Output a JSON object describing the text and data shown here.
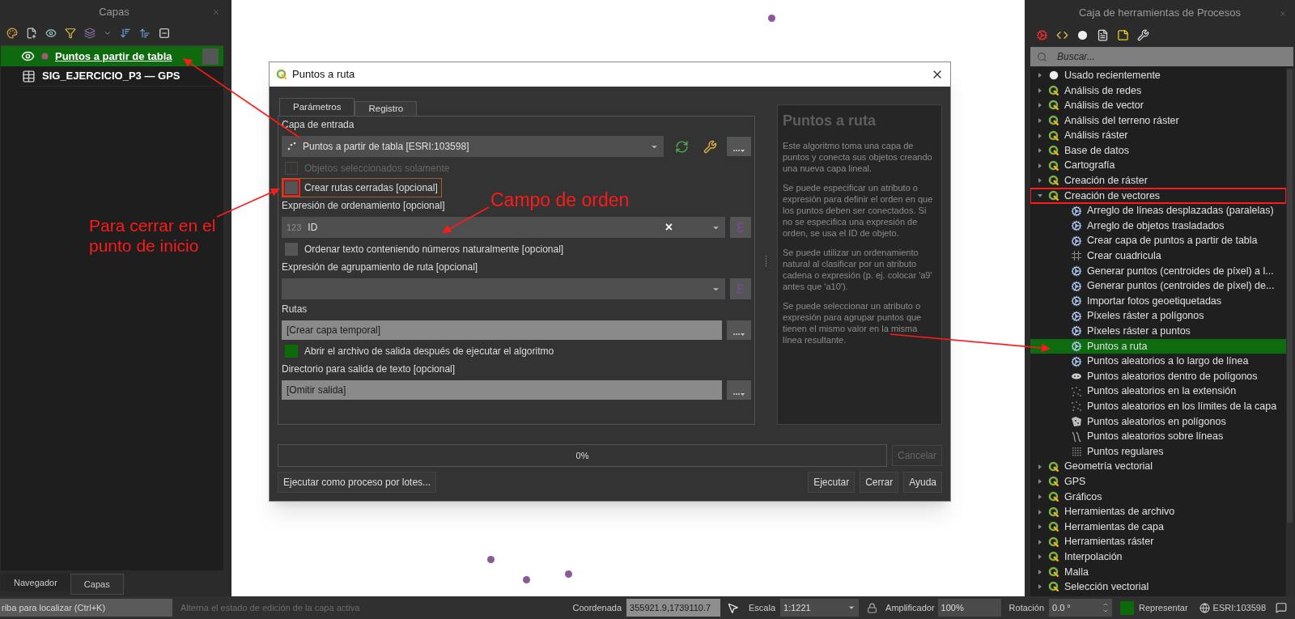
{
  "layers_panel": {
    "title": "Capas",
    "layers": [
      {
        "name": "Puntos a partir de tabla",
        "kind": "points",
        "selected": true
      },
      {
        "name": "SIG_EJERCICIO_P3 — GPS",
        "kind": "table",
        "selected": false
      }
    ],
    "tabs": [
      {
        "label": "Navegador",
        "selected": false
      },
      {
        "label": "Capas",
        "selected": true
      }
    ]
  },
  "dialog": {
    "title": "Puntos a ruta",
    "tabs": [
      {
        "label": "Parámetros",
        "selected": true
      },
      {
        "label": "Registro",
        "selected": false
      }
    ],
    "params": [
      {
        "kind": "label",
        "text": "Capa de entrada"
      },
      {
        "kind": "layer_select",
        "value": "Puntos a partir de tabla [ESRI:103598]"
      },
      {
        "kind": "checkbox",
        "label": "Objetos seleccionados solamente",
        "checked": false,
        "disabled": true
      },
      {
        "kind": "checkbox",
        "label": "Crear rutas cerradas [opcional]",
        "checked": false,
        "focused": true,
        "outlined": true
      },
      {
        "kind": "label",
        "text": "Expresión de ordenamiento [opcional]"
      },
      {
        "kind": "field_select",
        "type_hint": "123",
        "value": "ID",
        "clear": "×"
      },
      {
        "kind": "checkbox",
        "label": "Ordenar texto conteniendo números naturalmente [opcional]",
        "checked": false
      },
      {
        "kind": "label",
        "text": "Expresión de agrupamiento de ruta [opcional]"
      },
      {
        "kind": "field_select"
      },
      {
        "kind": "label",
        "text": "Rutas"
      },
      {
        "kind": "output",
        "value": "[Crear capa temporal]"
      },
      {
        "kind": "checkbox",
        "label": "Abrir el archivo de salida después de ejecutar el algoritmo",
        "checked": true
      },
      {
        "kind": "label",
        "text": "Directorio para salida de texto [opcional]"
      },
      {
        "kind": "output",
        "value": "[Omitir salida]"
      }
    ],
    "help": {
      "title": "Puntos a ruta",
      "paragraphs": [
        "Este algoritmo toma una capa de puntos y conecta sus objetos creando una nueva capa lineal.",
        "Se puede especificar un atributo o expresión para definir el orden en que los puntos deben ser conectados. Si no se especifica una expresión de orden, se usa el ID de objeto.",
        "Se puede utilizar un ordenamiento natural al clasificar por un atributo cadena o expresión (p. ej. colocar 'a9' antes que 'a10').",
        "Se puede seleccionar un atributo o expresión para agrupar puntos que tienen el mismo valor en la misma línea resultante."
      ]
    },
    "progress": {
      "text": "0%",
      "level": 0
    },
    "cancel": {
      "label": "Cancelar",
      "disabled": true
    },
    "batch_button": "Ejecutar como proceso por lotes...",
    "buttons": [
      "Ejecutar",
      "Cerrar",
      "Ayuda"
    ]
  },
  "toolbox": {
    "title": "Caja de herramientas de Procesos",
    "search": {
      "placeholder": "Buscar..."
    },
    "tree": [
      {
        "label": "Usado recientemente",
        "kind": "recent",
        "expanded": false,
        "outlined": false
      },
      {
        "label": "Análisis de redes",
        "kind": "provider",
        "expanded": false,
        "outlined": false
      },
      {
        "label": "Análisis de vector",
        "kind": "provider",
        "expanded": false,
        "outlined": false
      },
      {
        "label": "Análisis del terreno ráster",
        "kind": "provider",
        "expanded": false,
        "outlined": false
      },
      {
        "label": "Análisis ráster",
        "kind": "provider",
        "expanded": false,
        "outlined": false
      },
      {
        "label": "Base de datos",
        "kind": "provider",
        "expanded": false,
        "outlined": false
      },
      {
        "label": "Cartografía",
        "kind": "provider",
        "expanded": false,
        "outlined": false
      },
      {
        "label": "Creación de ráster",
        "kind": "provider",
        "expanded": false,
        "outlined": false
      },
      {
        "label": "Creación de vectores",
        "kind": "provider",
        "expanded": true,
        "outlined": true,
        "children": [
          {
            "label": "Arreglo de líneas desplazadas (paralelas)",
            "kind": "gear",
            "selected": false
          },
          {
            "label": "Arreglo de objetos trasladados",
            "kind": "gear",
            "selected": false
          },
          {
            "label": "Crear capa de puntos a partir de tabla",
            "kind": "gear",
            "selected": false
          },
          {
            "label": "Crear cuadricula",
            "kind": "grid",
            "selected": false
          },
          {
            "label": "Generar puntos (centroides de píxel) a l...",
            "kind": "gear",
            "selected": false
          },
          {
            "label": "Generar puntos (centroides de píxel) de...",
            "kind": "gear",
            "selected": false
          },
          {
            "label": "Importar fotos geoetiquetadas",
            "kind": "gear",
            "selected": false
          },
          {
            "label": "Píxeles ráster a polígonos",
            "kind": "gear",
            "selected": false
          },
          {
            "label": "Píxeles ráster a puntos",
            "kind": "gear",
            "selected": false
          },
          {
            "label": "Puntos a ruta",
            "kind": "gear",
            "selected": true
          },
          {
            "label": "Puntos aleatorios a lo largo de línea",
            "kind": "gear",
            "selected": false
          },
          {
            "label": "Puntos aleatorios dentro de polígonos",
            "kind": "blob",
            "selected": false
          },
          {
            "label": "Puntos aleatorios en la extensión",
            "kind": "dots",
            "selected": false
          },
          {
            "label": "Puntos aleatorios en los límites de la capa",
            "kind": "dots",
            "selected": false
          },
          {
            "label": "Puntos aleatorios en polígonos",
            "kind": "polygon",
            "selected": false
          },
          {
            "label": "Puntos aleatorios sobre líneas",
            "kind": "lines",
            "selected": false
          },
          {
            "label": "Puntos regulares",
            "kind": "regular",
            "selected": false
          }
        ]
      },
      {
        "label": "Geometría vectorial",
        "kind": "provider",
        "expanded": false,
        "outlined": false
      },
      {
        "label": "GPS",
        "kind": "provider",
        "expanded": false,
        "outlined": false
      },
      {
        "label": "Gráficos",
        "kind": "provider",
        "expanded": false,
        "outlined": false
      },
      {
        "label": "Herramientas de archivo",
        "kind": "provider",
        "expanded": false,
        "outlined": false
      },
      {
        "label": "Herramientas de capa",
        "kind": "provider",
        "expanded": false,
        "outlined": false
      },
      {
        "label": "Herramientas ráster",
        "kind": "provider",
        "expanded": false,
        "outlined": false
      },
      {
        "label": "Interpolación",
        "kind": "provider",
        "expanded": false,
        "outlined": false
      },
      {
        "label": "Malla",
        "kind": "provider",
        "expanded": false,
        "outlined": false
      },
      {
        "label": "Selección vectorial",
        "kind": "provider",
        "expanded": false,
        "outlined": false
      }
    ]
  },
  "status_bar": {
    "locator": "riba para localizar (Ctrl+K)",
    "message": "Alterna el estado de edición de la capa activa",
    "coordinate_label": "Coordenada",
    "coordinate": "355921.9,1739110.7",
    "scale_label": "Escala",
    "scale": "1:1221",
    "magnifier_label": "Amplificador",
    "magnifier": "100%",
    "rotation_label": "Rotación",
    "rotation": "0.0 °",
    "render": {
      "label": "Representar",
      "checked": true
    },
    "crs": "ESRI:103598"
  },
  "annotations": [
    {
      "text": "Para cerrar en el punto de inicio"
    },
    {
      "text": "Campo de orden"
    }
  ]
}
